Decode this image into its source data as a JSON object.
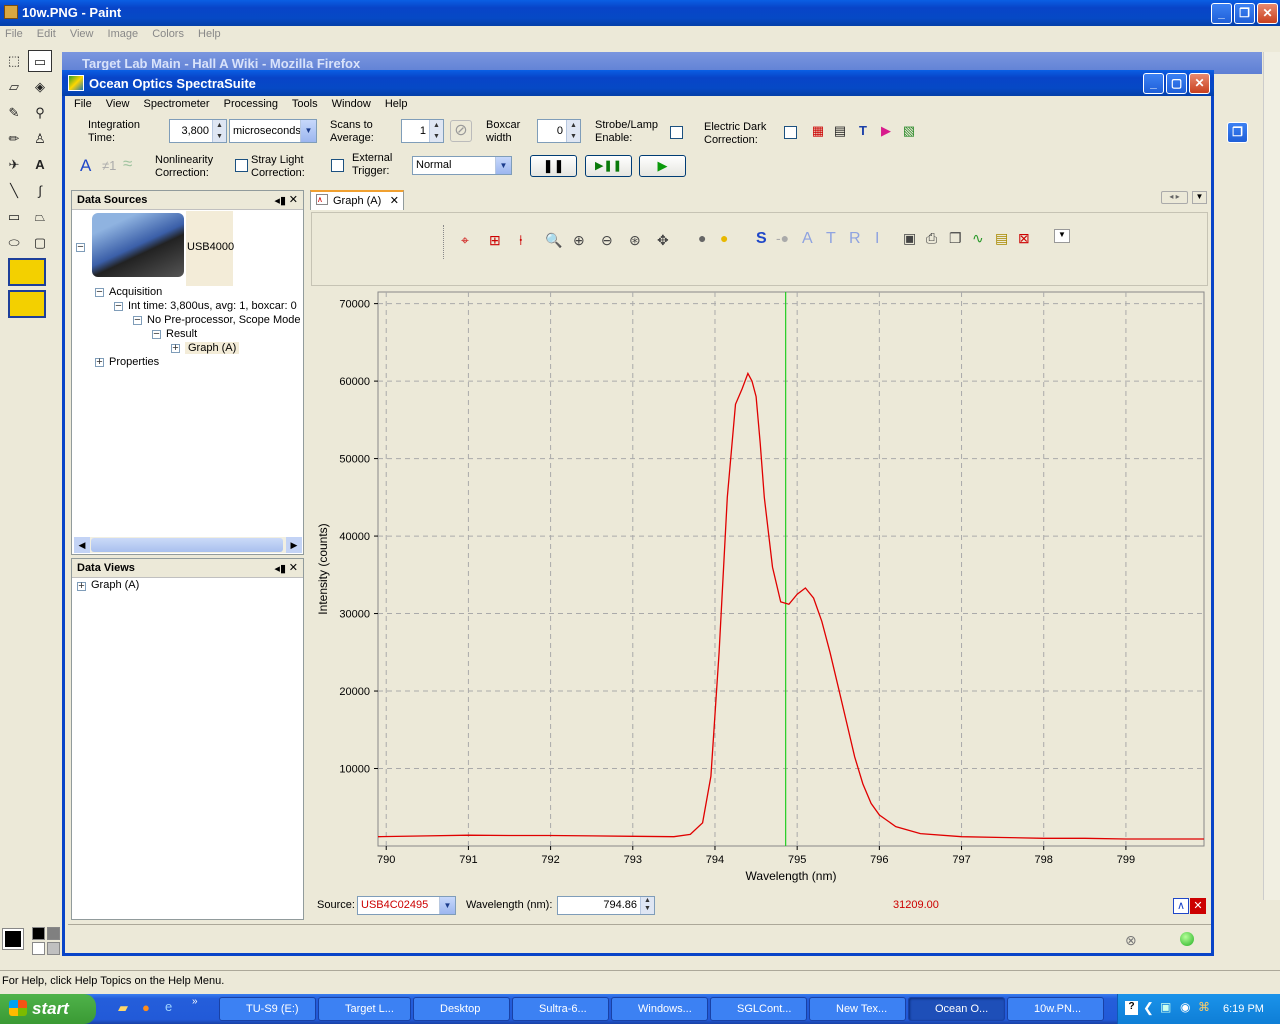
{
  "paint": {
    "title": "10w.PNG - Paint",
    "menu": [
      "File",
      "Edit",
      "View",
      "Image",
      "Colors",
      "Help"
    ],
    "status": "For Help, click Help Topics on the Help Menu."
  },
  "firefox": {
    "title": "Target Lab Main - Hall A Wiki - Mozilla Firefox"
  },
  "spectra": {
    "title": "Ocean Optics SpectraSuite",
    "menu": [
      "File",
      "View",
      "Spectrometer",
      "Processing",
      "Tools",
      "Window",
      "Help"
    ],
    "integration_label1": "Integration",
    "integration_label2": "Time:",
    "integration_value": "3,800",
    "integration_unit": "microseconds",
    "scans_label1": "Scans to",
    "scans_label2": "Average:",
    "scans_value": "1",
    "boxcar_label1": "Boxcar",
    "boxcar_label2": "width",
    "boxcar_value": "0",
    "strobe_label1": "Strobe/Lamp",
    "strobe_label2": "Enable:",
    "dark_label1": "Electric Dark",
    "dark_label2": "Correction:",
    "nonlin_label1": "Nonlinearity",
    "nonlin_label2": "Correction:",
    "stray_label1": "Stray Light",
    "stray_label2": "Correction:",
    "trigger_label1": "External",
    "trigger_label2": "Trigger:",
    "trigger_value": "Normal",
    "sources": {
      "title": "Data Sources",
      "device": "USB4000",
      "acquisition": "Acquisition",
      "inttime": "Int time: 3,800us, avg: 1, boxcar: 0",
      "preproc": "No Pre-processor, Scope Mode",
      "result": "Result",
      "graph": "Graph (A)",
      "properties": "Properties"
    },
    "views": {
      "title": "Data Views",
      "graph": "Graph (A)"
    },
    "graph_tab": "Graph (A)",
    "letters": [
      "S",
      "A",
      "T",
      "R",
      "I"
    ],
    "source_label": "Source:",
    "source_value": "USB4C02495",
    "wavelength_label": "Wavelength (nm):",
    "wavelength_value": "794.86",
    "readout": "31209.00"
  },
  "taskbar": {
    "start": "start",
    "items": [
      "TU-S9 (E:)",
      "Target L...",
      "Desktop",
      "Sultra-6...",
      "Windows...",
      "SGLCont...",
      "New Tex...",
      "Ocean O...",
      "10w.PN..."
    ],
    "clock": "6:19 PM"
  },
  "chart_data": {
    "type": "line",
    "xlabel": "Wavelength (nm)",
    "ylabel": "Intensity (counts)",
    "xlim": [
      789.9,
      799.95
    ],
    "ylim": [
      0,
      71500
    ],
    "xticks": [
      790,
      791,
      792,
      793,
      794,
      795,
      796,
      797,
      798,
      799
    ],
    "yticks": [
      10000,
      20000,
      30000,
      40000,
      50000,
      60000,
      70000
    ],
    "grid": true,
    "cursor_x": 794.86,
    "series": [
      {
        "color": "#e00000",
        "x": [
          789.9,
          790.5,
          791,
          791.5,
          792,
          792.5,
          793,
          793.5,
          793.7,
          793.85,
          793.95,
          794.05,
          794.15,
          794.25,
          794.33,
          794.4,
          794.45,
          794.5,
          794.55,
          794.6,
          794.7,
          794.8,
          794.9,
          795.0,
          795.1,
          795.2,
          795.3,
          795.4,
          795.5,
          795.6,
          795.7,
          795.8,
          795.9,
          796.0,
          796.2,
          796.5,
          797,
          797.5,
          798,
          798.5,
          799,
          799.5,
          799.95
        ],
        "y": [
          1200,
          1300,
          1400,
          1350,
          1350,
          1300,
          1250,
          1200,
          1500,
          3000,
          9000,
          25000,
          45000,
          57000,
          59000,
          61000,
          60000,
          58000,
          52000,
          45000,
          36000,
          31500,
          31200,
          32500,
          33300,
          32000,
          29000,
          25000,
          20500,
          16000,
          11500,
          8000,
          5500,
          4000,
          2500,
          1600,
          1200,
          1100,
          1000,
          1000,
          900,
          900,
          900
        ]
      }
    ]
  }
}
